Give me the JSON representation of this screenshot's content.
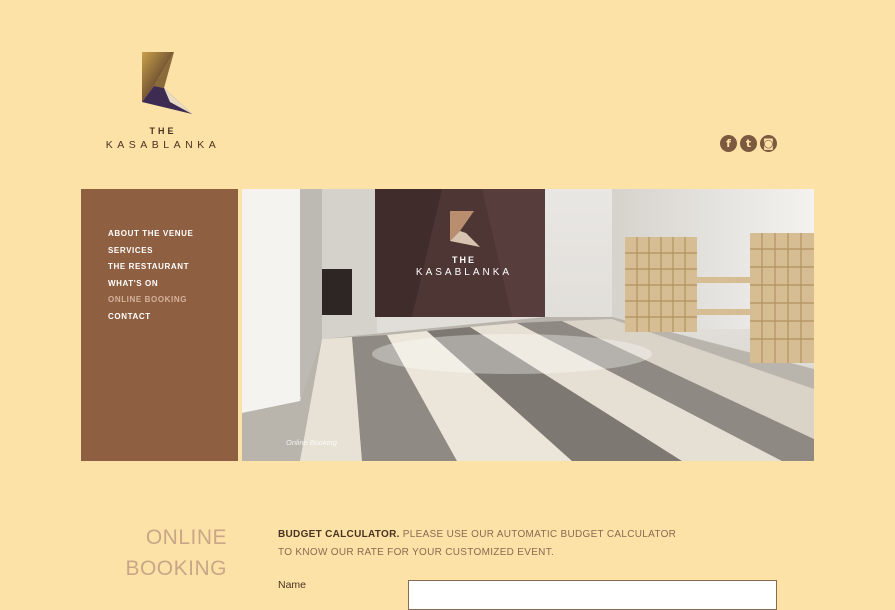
{
  "brand": {
    "the": "THE",
    "name": "KASABLANKA"
  },
  "social": [
    {
      "icon": "facebook-icon",
      "glyph": "f"
    },
    {
      "icon": "twitter-icon",
      "glyph": "t"
    },
    {
      "icon": "instagram-icon",
      "glyph": "◙"
    }
  ],
  "nav": {
    "items": [
      "ABOUT THE VENUE",
      "SERVICES",
      "THE RESTAURANT",
      "WHAT'S ON",
      "ONLINE BOOKING",
      "CONTACT"
    ],
    "active": "ONLINE BOOKING"
  },
  "hero": {
    "caption": "Online Booking",
    "wall_brand_the": "THE",
    "wall_brand_name": "KASABLANKA"
  },
  "page": {
    "heading_line1": "ONLINE",
    "heading_line2": "BOOKING",
    "intro_strong": "BUDGET CALCULATOR.",
    "intro_rest": " PLEASE USE OUR AUTOMATIC BUDGET CALCULATOR",
    "intro_line2": "TO KNOW OUR RATE FOR YOUR CUSTOMIZED EVENT."
  },
  "form": {
    "name_label": "Name",
    "name_value": ""
  },
  "colors": {
    "background": "#fde2a8",
    "sidebar": "#8e5f41",
    "accent": "#7b5a40"
  }
}
